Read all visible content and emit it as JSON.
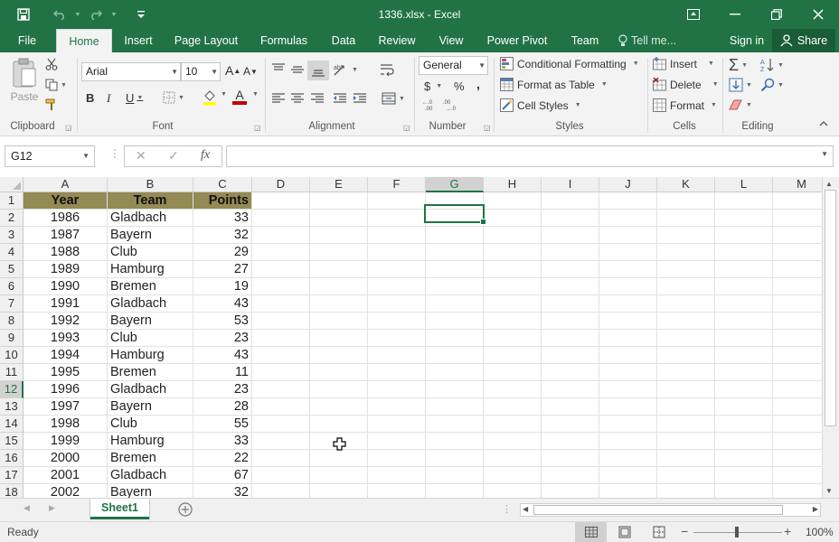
{
  "titlebar": {
    "title": "1336.xlsx - Excel",
    "save_icon": "save-icon",
    "undo_icon": "undo-icon",
    "redo_icon": "redo-icon",
    "customize_icon": "customize-qat-icon",
    "ribbon_display_icon": "ribbon-display-options-icon",
    "minimize_icon": "minimize-icon",
    "restore_icon": "restore-icon",
    "close_icon": "close-icon"
  },
  "tabs": {
    "file": "File",
    "home": "Home",
    "insert": "Insert",
    "page_layout": "Page Layout",
    "formulas": "Formulas",
    "data": "Data",
    "review": "Review",
    "view": "View",
    "power_pivot": "Power Pivot",
    "team": "Team",
    "tell_me": "Tell me...",
    "sign_in": "Sign in",
    "share": "Share"
  },
  "ribbon": {
    "clipboard": {
      "label": "Clipboard",
      "paste": "Paste"
    },
    "font": {
      "label": "Font",
      "font_name": "Arial",
      "font_size": "10",
      "bold": "B",
      "italic": "I",
      "underline": "U",
      "grow": "A",
      "shrink": "A",
      "font_color": "A"
    },
    "alignment": {
      "label": "Alignment"
    },
    "number": {
      "label": "Number",
      "format": "General",
      "currency": "$",
      "percent": "%",
      "comma": ","
    },
    "styles": {
      "label": "Styles",
      "conditional_formatting": "Conditional Formatting",
      "format_as_table": "Format as Table",
      "cell_styles": "Cell Styles"
    },
    "cells": {
      "label": "Cells",
      "insert": "Insert",
      "delete": "Delete",
      "format": "Format"
    },
    "editing": {
      "label": "Editing"
    }
  },
  "formula_bar": {
    "name_box": "G12",
    "cancel": "✕",
    "enter": "✓",
    "function": "fx",
    "value": ""
  },
  "sheet": {
    "columns": [
      "A",
      "B",
      "C",
      "D",
      "E",
      "F",
      "G",
      "H",
      "I",
      "J",
      "K",
      "L",
      "M"
    ],
    "selected_column": "G",
    "selected_row": "12",
    "row_numbers": [
      "1",
      "2",
      "3",
      "4",
      "5",
      "6",
      "7",
      "8",
      "9",
      "10",
      "11",
      "12",
      "13",
      "14",
      "15",
      "16",
      "17",
      "18"
    ],
    "header_row": [
      "Year",
      "Team",
      "Points"
    ],
    "rows": [
      [
        "1986",
        "Gladbach",
        "33"
      ],
      [
        "1987",
        "Bayern",
        "32"
      ],
      [
        "1988",
        "Club",
        "29"
      ],
      [
        "1989",
        "Hamburg",
        "27"
      ],
      [
        "1990",
        "Bremen",
        "19"
      ],
      [
        "1991",
        "Gladbach",
        "43"
      ],
      [
        "1992",
        "Bayern",
        "53"
      ],
      [
        "1993",
        "Club",
        "23"
      ],
      [
        "1994",
        "Hamburg",
        "43"
      ],
      [
        "1995",
        "Bremen",
        "11"
      ],
      [
        "1996",
        "Gladbach",
        "23"
      ],
      [
        "1997",
        "Bayern",
        "28"
      ],
      [
        "1998",
        "Club",
        "55"
      ],
      [
        "1999",
        "Hamburg",
        "33"
      ],
      [
        "2000",
        "Bremen",
        "22"
      ],
      [
        "2001",
        "Gladbach",
        "67"
      ],
      [
        "2002",
        "Bayern",
        "32"
      ]
    ],
    "header_fill_color": "#948a54",
    "accent_color": "#217346"
  },
  "sheet_tabs": {
    "active": "Sheet1",
    "add_icon": "add-sheet-icon"
  },
  "status": {
    "ready": "Ready",
    "zoom": "100%",
    "minus": "−",
    "plus": "+"
  }
}
